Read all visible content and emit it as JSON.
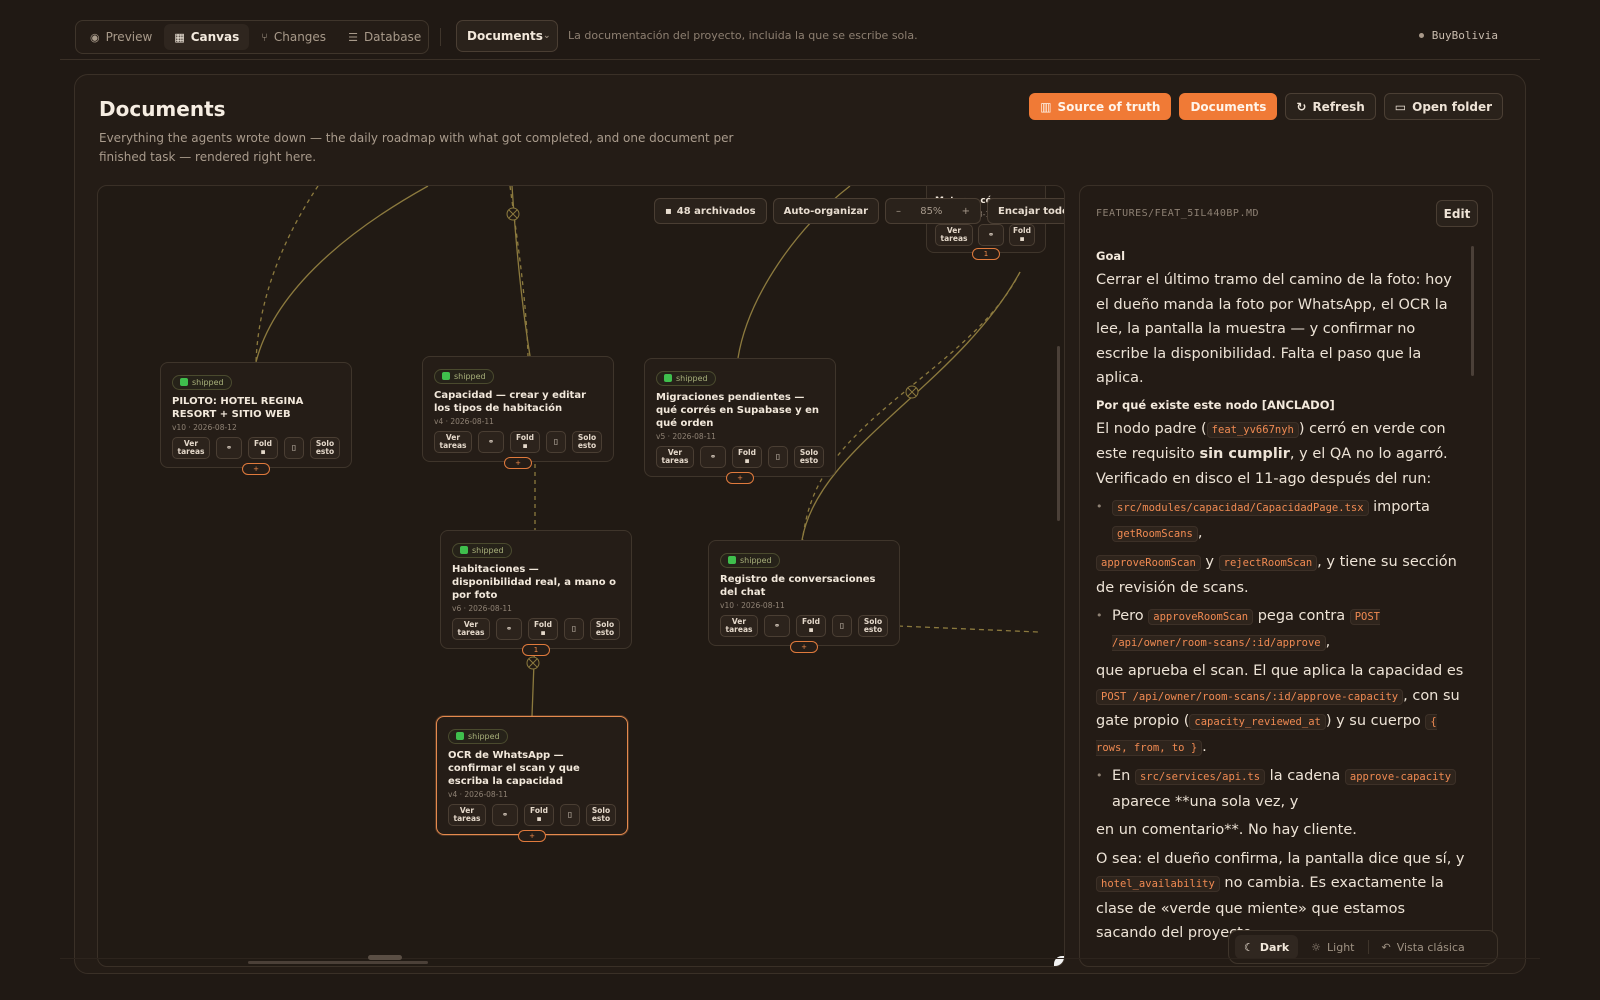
{
  "topbar": {
    "tabs": [
      {
        "label": "Preview",
        "icon": "eye-icon"
      },
      {
        "label": "Canvas",
        "icon": "grid-icon",
        "active": true
      },
      {
        "label": "Changes",
        "icon": "git-branch-icon"
      },
      {
        "label": "Database",
        "icon": "database-icon"
      }
    ],
    "doc_select": "Documents",
    "subtitle": "La documentación del proyecto, incluida la que se escribe sola.",
    "brand": "BuyBolivia"
  },
  "page": {
    "title": "Documents",
    "description": "Everything the agents wrote down — the daily roadmap with what got completed, and one document per finished task — rendered right here.",
    "actions": {
      "source_of_truth": "Source of truth",
      "documents": "Documents",
      "refresh": "Refresh",
      "open_folder": "Open folder"
    },
    "accent": "#f07a36"
  },
  "canvas": {
    "archived": "48 archivados",
    "auto_organize": "Auto-organizar",
    "zoom_minus": "–",
    "zoom_level": "85%",
    "zoom_plus": "+",
    "fit_all": "Encajar todo",
    "partial_node": {
      "title": "Motor … cóm…",
      "meta": "v2 · 2026-08-11",
      "fold": "Fold"
    },
    "node_labels": {
      "status": "shipped",
      "ver_tareas": "Ver tareas",
      "fold": "Fold",
      "solo_esto": "Solo esto"
    },
    "nodes": [
      {
        "title": "PILOTO: HOTEL REGINA RESORT + SITIO WEB",
        "meta": "v10 · 2026-08-12",
        "handle": "+"
      },
      {
        "title": "Capacidad — crear y editar los tipos de habitación",
        "meta": "v4 · 2026-08-11",
        "handle": "+"
      },
      {
        "title": "Migraciones pendientes — qué corrés en Supabase y en qué orden",
        "meta": "v5 · 2026-08-11",
        "handle": "+"
      },
      {
        "title": "Habitaciones — disponibilidad real, a mano o por foto",
        "meta": "v6 · 2026-08-11",
        "handle": "1"
      },
      {
        "title": "Registro de conversaciones del chat",
        "meta": "v10 · 2026-08-11",
        "handle": "+"
      },
      {
        "title": "OCR de WhatsApp — confirmar el scan y que escriba la capacidad",
        "meta": "v4 · 2026-08-11",
        "handle": "+",
        "selected": true
      }
    ]
  },
  "reader": {
    "path": "FEATURES/FEAT_5IL440BP.MD",
    "edit": "Edit",
    "goal_heading": "Goal",
    "goal_text": "Cerrar el último tramo del camino de la foto: hoy el dueño manda la foto por WhatsApp, el OCR la lee, la pantalla la muestra — y confirmar no escribe la disponibilidad. Falta el paso que la aplica.",
    "why_heading": "Por qué existe este nodo [ANCLADO]",
    "p1_a": "El nodo padre (",
    "p1_code": "feat_yv667nyh",
    "p1_b": ") cerró en verde con este requisito",
    "p1_bold": "sin cumplir",
    "p1_c": ", y el QA no lo agarró. Verificado en disco el 11-ago después del run:",
    "b1_code1": "src/modules/capacidad/CapacidadPage.tsx",
    "b1_text": " importa",
    "b1_code2": "getRoomScans",
    "b1_comma": ",",
    "p2_code1": "approveRoomScan",
    "p2_y": " y ",
    "p2_code2": "rejectRoomScan",
    "p2_text": ", y tiene su sección de revisión de scans.",
    "b2_a": "Pero ",
    "b2_code1": "approveRoomScan",
    "b2_b": " pega contra ",
    "b2_code2": "POST /api/owner/room-scans/:id/approve",
    "b2_comma": ",",
    "p3_a": "que aprueba el scan. El que aplica la capacidad es ",
    "p3_code1": "POST /api/owner/room-scans/:id/approve-capacity",
    "p3_b": ", con su gate propio (",
    "p3_code2": "capacity_reviewed_at",
    "p3_c": ") y su cuerpo ",
    "p3_code3": "{ rows, from, to }",
    "p3_d": ".",
    "b3_a": "En ",
    "b3_code1": "src/services/api.ts",
    "b3_b": " la cadena ",
    "b3_code2": "approve-capacity",
    "b3_c": " aparece **una sola vez, y",
    "p4": "en un comentario**. No hay cliente.",
    "p5_a": "O sea: el dueño confirma, la pantalla dice que sí, y ",
    "p5_code": "hotel_availability",
    "p5_b": " no cambia. Es exactamente la clase de «verde que miente» que estamos sacando del proyecto."
  },
  "theme": {
    "dark": "Dark",
    "light": "Light",
    "classic": "Vista clásica"
  }
}
